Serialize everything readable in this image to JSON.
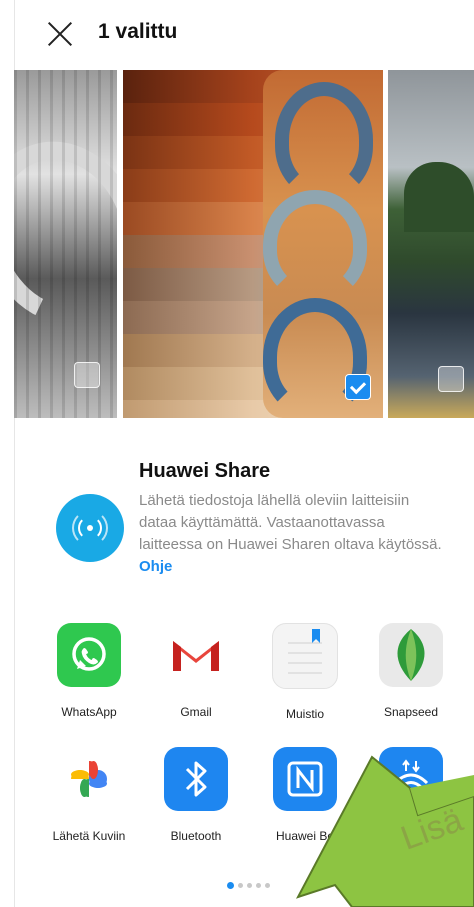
{
  "header": {
    "title": "1 valittu",
    "close_icon": "close-icon"
  },
  "photos": [
    {
      "name": "photo-bw-horseshoe",
      "selected": false
    },
    {
      "name": "photo-horseshoes-logs",
      "selected": true
    },
    {
      "name": "photo-lake",
      "selected": false
    }
  ],
  "huawei_share": {
    "title": "Huawei Share",
    "description": "Lähetä tiedostoja lähellä oleviin laitteisiin dataa käyttämättä. Vastaanottavassa laitteessa on Huawei Sharen oltava käytössä.",
    "help_link": "Ohje",
    "icon": "wireless-share-icon",
    "accent": "#19a9e5"
  },
  "apps": [
    {
      "label": "WhatsApp",
      "icon": "whatsapp-icon",
      "color": "#25c345"
    },
    {
      "label": "Gmail",
      "icon": "gmail-icon",
      "color": "#ea4335"
    },
    {
      "label": "Muistio",
      "icon": "notepad-icon",
      "color": "#1a8cf0"
    },
    {
      "label": "Snapseed",
      "icon": "snapseed-icon",
      "color": "#2e9b3a"
    },
    {
      "label": "Lähetä Kuviin",
      "icon": "google-photos-icon",
      "color": "#fbbc05"
    },
    {
      "label": "Bluetooth",
      "icon": "bluetooth-icon",
      "color": "#1e86f0"
    },
    {
      "label": "Huawei Be",
      "icon": "nfc-icon",
      "color": "#1e86f0"
    },
    {
      "label": "",
      "icon": "wireless-projection-icon",
      "color": "#1e86f0"
    }
  ],
  "pager": {
    "pages": 5,
    "active": 1
  },
  "overlay": {
    "arrow_text": "Lisä",
    "arrow_color": "#8ba545"
  }
}
